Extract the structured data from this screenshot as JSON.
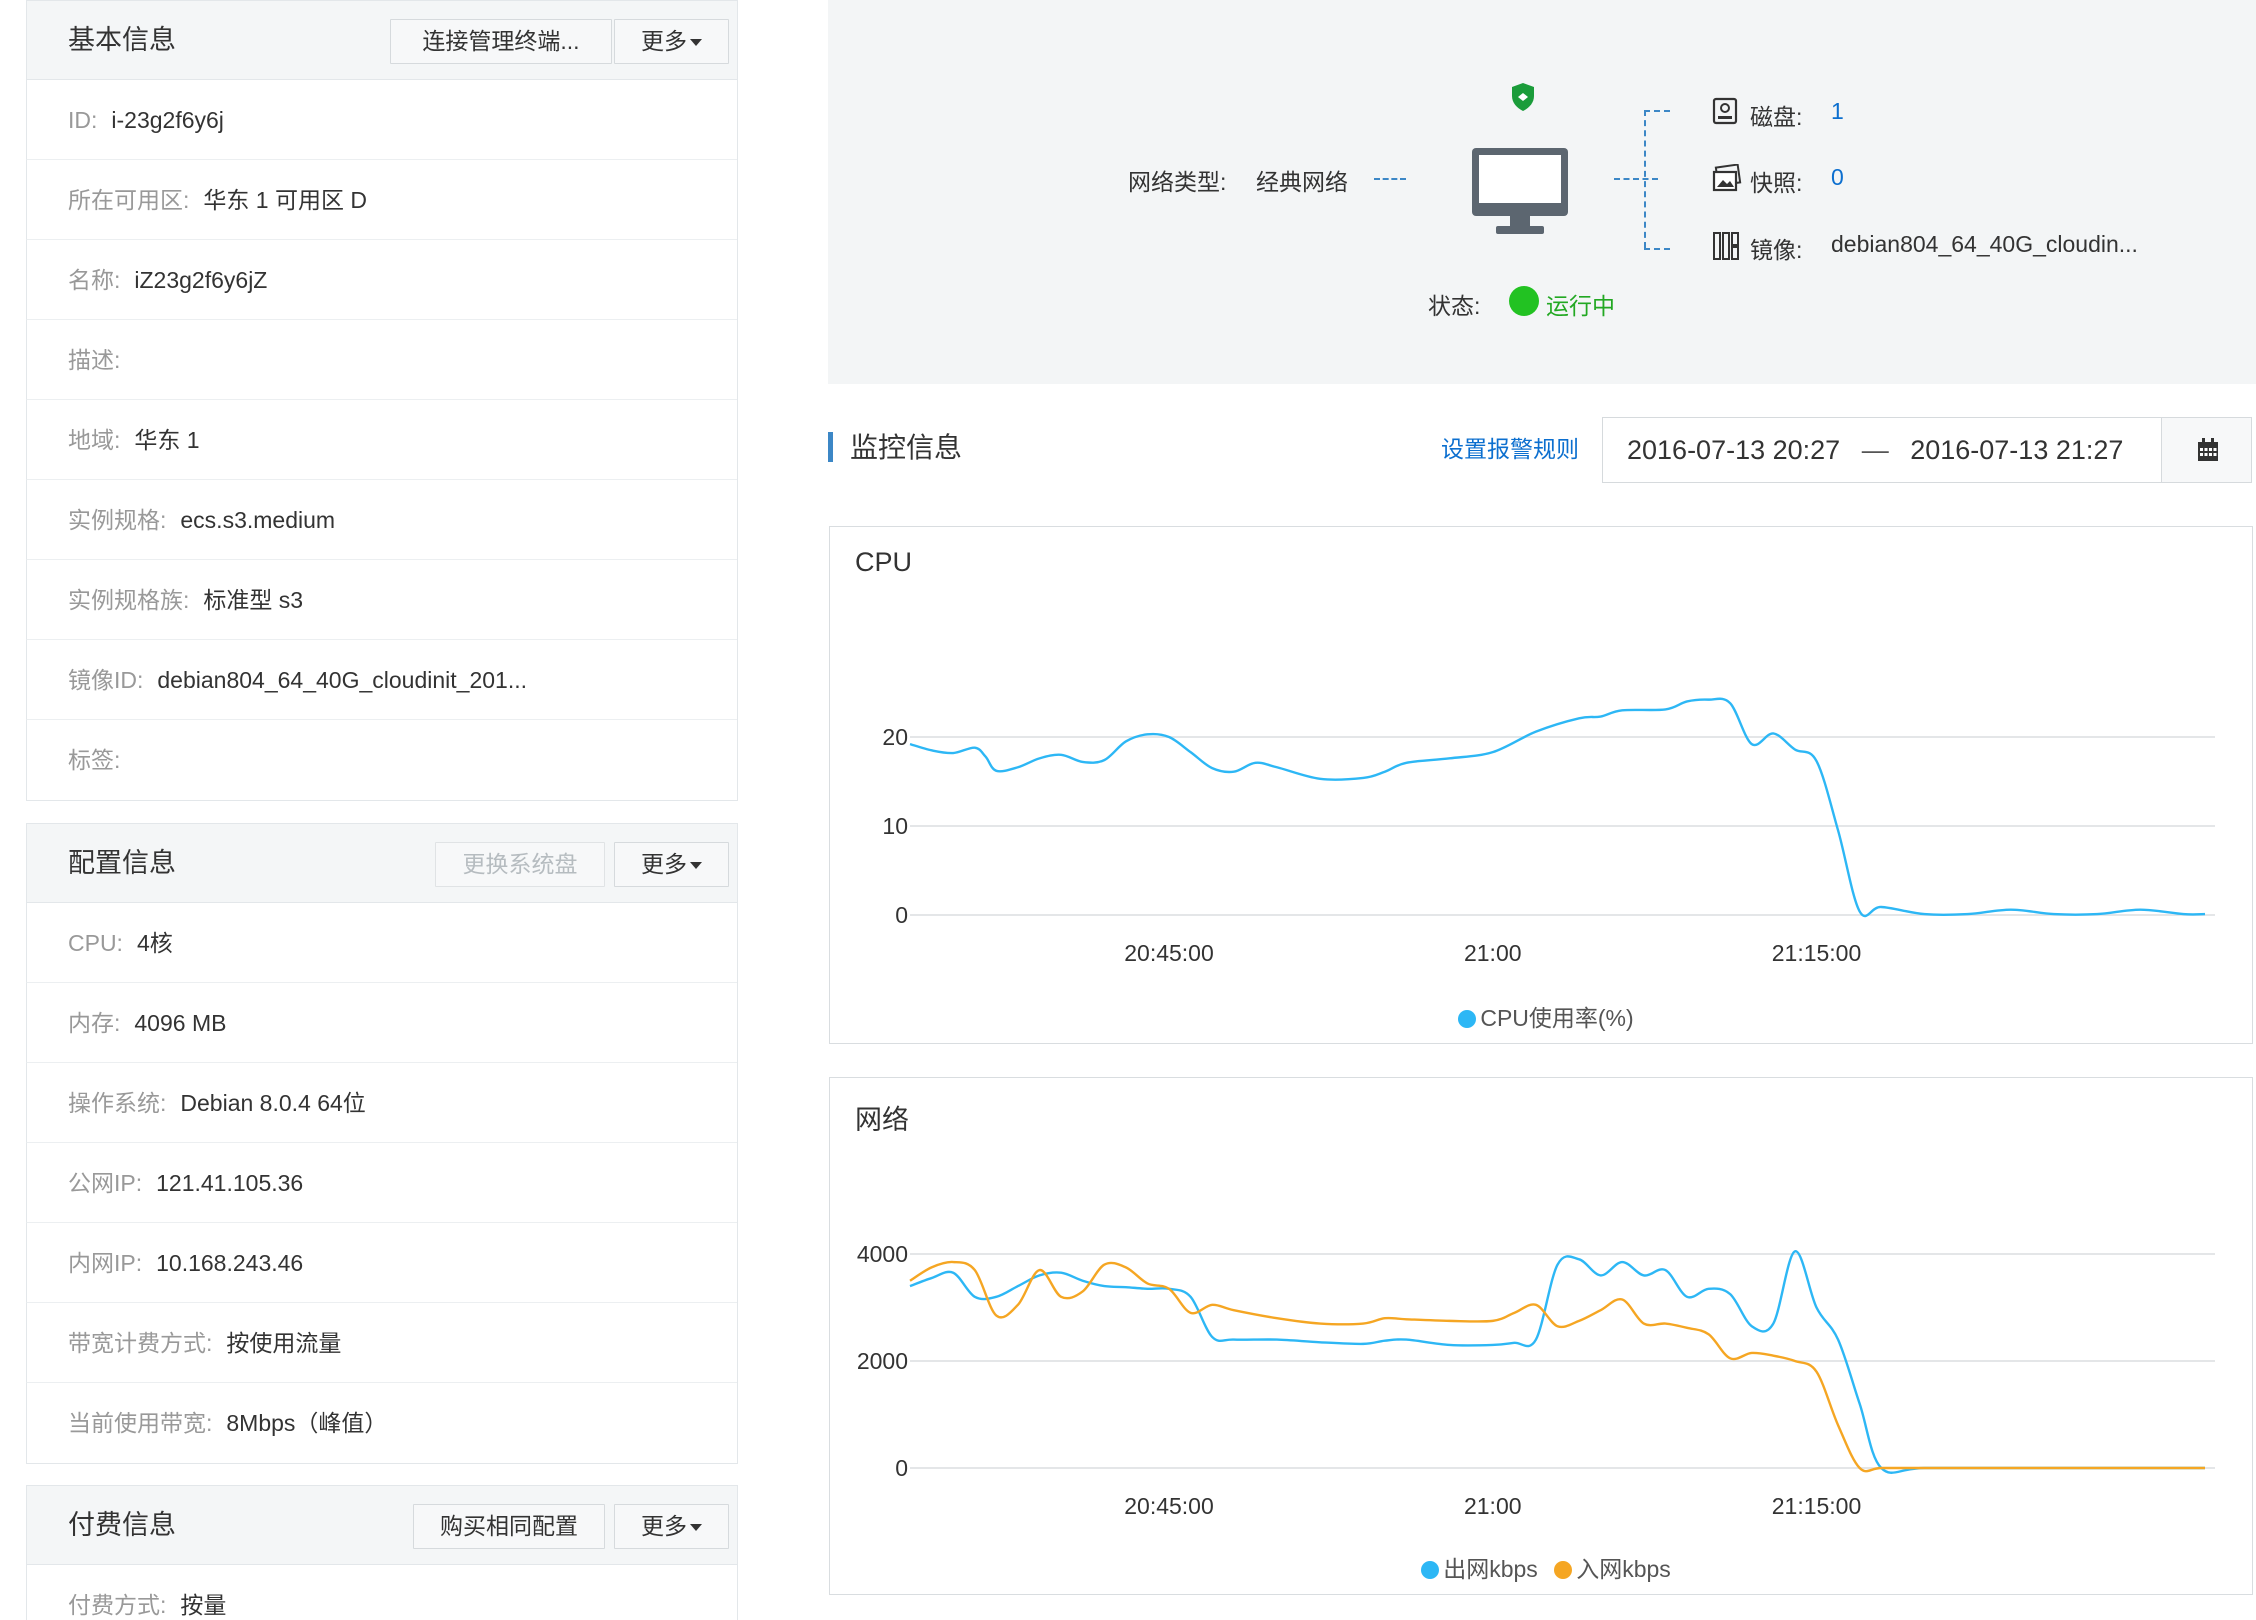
{
  "basic": {
    "title": "基本信息",
    "buttons": {
      "connect": "连接管理终端...",
      "more": "更多"
    },
    "rows": [
      {
        "label": "ID:",
        "value": "i-23g2f6y6j"
      },
      {
        "label": "所在可用区:",
        "value": "华东 1 可用区 D"
      },
      {
        "label": "名称:",
        "value": "iZ23g2f6y6jZ"
      },
      {
        "label": "描述:",
        "value": ""
      },
      {
        "label": "地域:",
        "value": "华东 1"
      },
      {
        "label": "实例规格:",
        "value": "ecs.s3.medium"
      },
      {
        "label": "实例规格族:",
        "value": "标准型 s3"
      },
      {
        "label": "镜像ID:",
        "value": "debian804_64_40G_cloudinit_201..."
      },
      {
        "label": "标签:",
        "value": ""
      }
    ]
  },
  "config": {
    "title": "配置信息",
    "buttons": {
      "change_disk": "更换系统盘",
      "more": "更多"
    },
    "rows": [
      {
        "label": "CPU:",
        "value": "4核"
      },
      {
        "label": "内存:",
        "value": "4096 MB"
      },
      {
        "label": "操作系统:",
        "value": "Debian 8.0.4 64位"
      },
      {
        "label": "公网IP:",
        "value": "121.41.105.36"
      },
      {
        "label": "内网IP:",
        "value": "10.168.243.46"
      },
      {
        "label": "带宽计费方式:",
        "value": "按使用流量"
      },
      {
        "label": "当前使用带宽:",
        "value": "8Mbps（峰值）"
      }
    ]
  },
  "billing": {
    "title": "付费信息",
    "buttons": {
      "buy_same": "购买相同配置",
      "more": "更多"
    },
    "rows": [
      {
        "label": "付费方式:",
        "value": "按量"
      }
    ]
  },
  "topology": {
    "network_label": "网络类型:",
    "network_value": "经典网络",
    "status_label": "状态:",
    "status_value": "运行中",
    "disk_label": "磁盘:",
    "disk_value": "1",
    "snapshot_label": "快照:",
    "snapshot_value": "0",
    "image_label": "镜像:",
    "image_value": "debian804_64_40G_cloudin...",
    "colors": {
      "running": "#22c222",
      "shield": "#1a9c3a",
      "link": "#0c6fcf"
    }
  },
  "monitor": {
    "title": "监控信息",
    "alarm_link": "设置报警规则",
    "range_start": "2016-07-13 20:27",
    "range_sep": "—",
    "range_end": "2016-07-13 21:27"
  },
  "chart_data": [
    {
      "type": "line",
      "title": "CPU",
      "x_ticks": [
        "20:45:00",
        "21:00",
        "21:15:00"
      ],
      "ylim": [
        0,
        20
      ],
      "y_ticks": [
        0,
        10,
        20
      ],
      "grid": true,
      "legend_position": "bottom",
      "series": [
        {
          "name": "CPU使用率(%)",
          "color": "#2db7f5",
          "x": [
            "20:33",
            "20:34",
            "20:35",
            "20:36",
            "20:36.5",
            "20:37",
            "20:38",
            "20:39",
            "20:40",
            "20:41",
            "20:42",
            "20:43",
            "20:44",
            "20:45",
            "20:46",
            "20:47",
            "20:48",
            "20:49",
            "20:50",
            "20:52",
            "20:54",
            "20:55",
            "20:56",
            "20:58",
            "21:00",
            "21:02",
            "21:04",
            "21:05",
            "21:06",
            "21:08",
            "21:09",
            "21:10",
            "21:11",
            "21:12",
            "21:13",
            "21:14",
            "21:15",
            "21:16",
            "21:17",
            "21:18",
            "21:20",
            "21:22",
            "21:24",
            "21:26",
            "21:28",
            "21:30",
            "21:32",
            "21:33"
          ],
          "values": [
            19.2,
            18.5,
            18.2,
            18.8,
            17.8,
            16.2,
            16.6,
            17.6,
            18.0,
            17.2,
            17.4,
            19.5,
            20.3,
            20.0,
            18.3,
            16.5,
            16.1,
            17.1,
            16.6,
            15.3,
            15.4,
            16.1,
            17.1,
            17.6,
            18.3,
            20.6,
            22.1,
            22.3,
            23.0,
            23.1,
            24.0,
            24.2,
            23.8,
            19.2,
            20.4,
            18.6,
            17.3,
            9.5,
            0.4,
            0.9,
            0.1,
            0.1,
            0.6,
            0.1,
            0.1,
            0.6,
            0.1,
            0.1
          ]
        }
      ]
    },
    {
      "type": "line",
      "title": "网络",
      "x_ticks": [
        "20:45:00",
        "21:00",
        "21:15:00"
      ],
      "ylim": [
        0,
        4000
      ],
      "y_ticks": [
        0,
        2000,
        4000
      ],
      "grid": true,
      "legend_position": "bottom",
      "series": [
        {
          "name": "出网kbps",
          "color": "#2db7f5",
          "x": [
            "20:33",
            "20:34",
            "20:35",
            "20:36",
            "20:37",
            "20:38",
            "20:39",
            "20:40",
            "20:41",
            "20:42",
            "20:43",
            "20:44",
            "20:45",
            "20:46",
            "20:47",
            "20:48",
            "20:50",
            "20:52",
            "20:54",
            "20:55",
            "20:56",
            "20:58",
            "21:00",
            "21:01",
            "21:02",
            "21:03",
            "21:04",
            "21:05",
            "21:06",
            "21:07",
            "21:08",
            "21:09",
            "21:10",
            "21:11",
            "21:12",
            "21:13",
            "21:14",
            "21:15",
            "21:16",
            "21:17",
            "21:18",
            "21:20",
            "21:25",
            "21:33"
          ],
          "values": [
            3400,
            3550,
            3650,
            3200,
            3200,
            3400,
            3600,
            3650,
            3500,
            3400,
            3380,
            3350,
            3350,
            3200,
            2450,
            2400,
            2400,
            2350,
            2320,
            2380,
            2400,
            2300,
            2300,
            2340,
            2400,
            3800,
            3900,
            3600,
            3850,
            3600,
            3700,
            3200,
            3350,
            3250,
            2650,
            2700,
            4050,
            3000,
            2400,
            1200,
            0,
            0,
            0,
            0
          ]
        },
        {
          "name": "入网kbps",
          "color": "#f5a623",
          "x": [
            "20:33",
            "20:34",
            "20:35",
            "20:36",
            "20:37",
            "20:38",
            "20:39",
            "20:40",
            "20:41",
            "20:42",
            "20:43",
            "20:44",
            "20:45",
            "20:46",
            "20:47",
            "20:48",
            "20:50",
            "20:52",
            "20:54",
            "20:55",
            "20:56",
            "20:58",
            "21:00",
            "21:01",
            "21:02",
            "21:03",
            "21:04",
            "21:05",
            "21:06",
            "21:07",
            "21:08",
            "21:09",
            "21:10",
            "21:11",
            "21:12",
            "21:13",
            "21:14",
            "21:15",
            "21:16",
            "21:17",
            "21:18",
            "21:20",
            "21:25",
            "21:33"
          ],
          "values": [
            3500,
            3750,
            3850,
            3700,
            2850,
            3050,
            3700,
            3200,
            3300,
            3800,
            3750,
            3450,
            3350,
            2900,
            3050,
            2950,
            2800,
            2700,
            2700,
            2800,
            2780,
            2750,
            2750,
            2900,
            3050,
            2650,
            2750,
            2950,
            3150,
            2700,
            2700,
            2620,
            2500,
            2050,
            2150,
            2100,
            2000,
            1800,
            800,
            0,
            0,
            0,
            0,
            0
          ]
        }
      ]
    }
  ]
}
